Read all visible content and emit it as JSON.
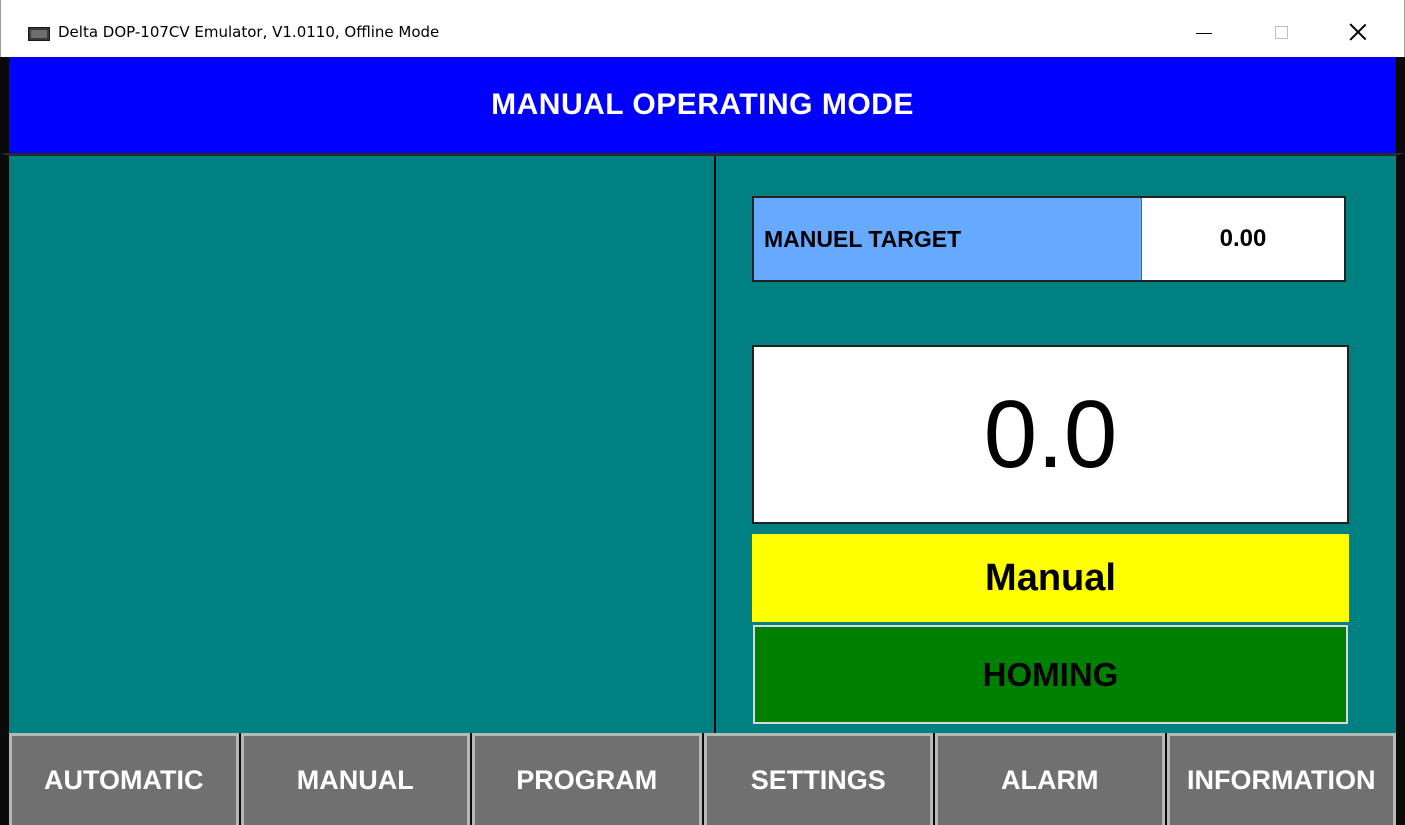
{
  "window": {
    "title": "Delta DOP-107CV Emulator, V1.0110, Offline Mode",
    "icon": "monitor-icon",
    "controls": [
      "minimize-icon",
      "maximize-icon",
      "close-icon"
    ]
  },
  "header": {
    "title": "MANUAL OPERATING MODE",
    "background": "#0000FF"
  },
  "panel": {
    "background": "#008080",
    "target": {
      "label": "MANUEL TARGET",
      "value": "0.00",
      "label_color": "#66AAFF"
    },
    "current_value": "0.0",
    "mode": {
      "label": "Manual",
      "color": "#FFFF00"
    },
    "homing": {
      "label": "HOMING",
      "color": "#008000"
    }
  },
  "nav": {
    "items": [
      {
        "label": "AUTOMATIC"
      },
      {
        "label": "MANUAL"
      },
      {
        "label": "PROGRAM"
      },
      {
        "label": "SETTINGS"
      },
      {
        "label": "ALARM"
      },
      {
        "label": "INFORMATION"
      }
    ],
    "button_color": "#707070"
  }
}
